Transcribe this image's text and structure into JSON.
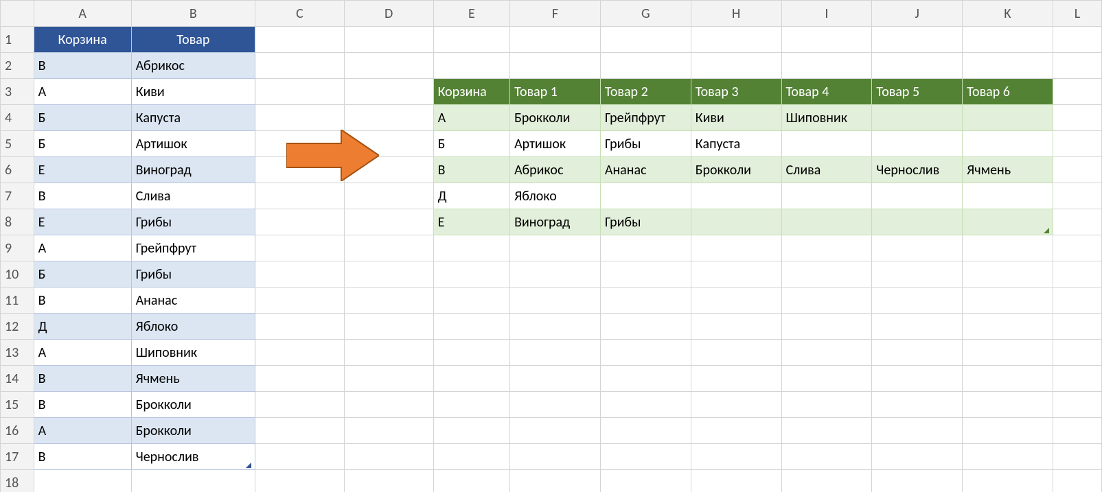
{
  "columns": [
    "A",
    "B",
    "C",
    "D",
    "E",
    "F",
    "G",
    "H",
    "I",
    "J",
    "K",
    "L"
  ],
  "rowCount": 18,
  "blueTable": {
    "headers": [
      "Корзина",
      "Товар"
    ],
    "rows": [
      [
        "В",
        "Абрикос"
      ],
      [
        "А",
        "Киви"
      ],
      [
        "Б",
        "Капуста"
      ],
      [
        "Б",
        "Артишок"
      ],
      [
        "Е",
        "Виноград"
      ],
      [
        "В",
        "Слива"
      ],
      [
        "Е",
        "Грибы"
      ],
      [
        "А",
        "Грейпфрут"
      ],
      [
        "Б",
        "Грибы"
      ],
      [
        "В",
        "Ананас"
      ],
      [
        "Д",
        "Яблоко"
      ],
      [
        "А",
        "Шиповник"
      ],
      [
        "В",
        "Ячмень"
      ],
      [
        "В",
        "Брокколи"
      ],
      [
        "А",
        "Брокколи"
      ],
      [
        "В",
        "Чернослив"
      ]
    ]
  },
  "greenTable": {
    "headers": [
      "Корзина",
      "Товар 1",
      "Товар 2",
      "Товар 3",
      "Товар 4",
      "Товар 5",
      "Товар 6"
    ],
    "rows": [
      [
        "А",
        "Брокколи",
        "Грейпфрут",
        "Киви",
        "Шиповник",
        "",
        ""
      ],
      [
        "Б",
        "Артишок",
        "Грибы",
        "Капуста",
        "",
        "",
        ""
      ],
      [
        "В",
        "Абрикос",
        "Ананас",
        "Брокколи",
        "Слива",
        "Чернослив",
        "Ячмень"
      ],
      [
        "Д",
        "Яблоко",
        "",
        "",
        "",
        "",
        ""
      ],
      [
        "Е",
        "Виноград",
        "Грибы",
        "",
        "",
        "",
        ""
      ]
    ]
  },
  "icons": {
    "arrow": "arrow-right-icon"
  }
}
